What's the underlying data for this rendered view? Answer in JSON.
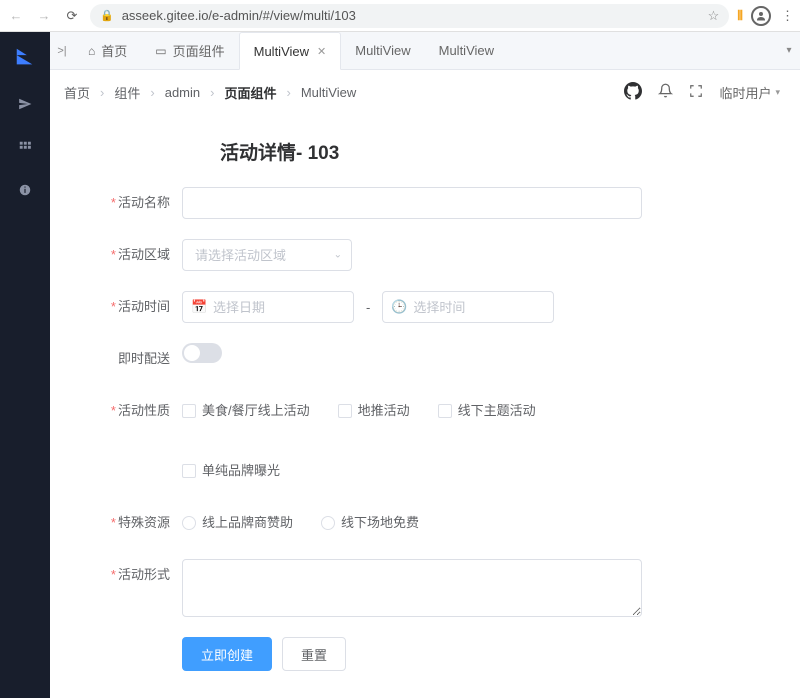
{
  "browser": {
    "url": "asseek.gitee.io/e-admin/#/view/multi/103"
  },
  "tabs": {
    "items": [
      {
        "label": "首页",
        "icon": "home"
      },
      {
        "label": "页面组件",
        "icon": "page"
      },
      {
        "label": "MultiView",
        "active": true,
        "closable": true
      },
      {
        "label": "MultiView"
      },
      {
        "label": "MultiView"
      }
    ]
  },
  "breadcrumb": {
    "items": [
      "首页",
      "组件",
      "admin",
      "页面组件",
      "MultiView"
    ],
    "bold_index": 3
  },
  "header": {
    "user_label": "临时用户"
  },
  "form": {
    "title": "活动详情- 103",
    "name_label": "活动名称",
    "region_label": "活动区域",
    "region_placeholder": "请选择活动区域",
    "time_label": "活动时间",
    "date_placeholder": "选择日期",
    "time_placeholder": "选择时间",
    "delivery_label": "即时配送",
    "nature_label": "活动性质",
    "nature_options": [
      "美食/餐厅线上活动",
      "地推活动",
      "线下主题活动",
      "单纯品牌曝光"
    ],
    "resource_label": "特殊资源",
    "resource_options": [
      "线上品牌商赞助",
      "线下场地免费"
    ],
    "desc_label": "活动形式",
    "submit_label": "立即创建",
    "reset_label": "重置"
  }
}
